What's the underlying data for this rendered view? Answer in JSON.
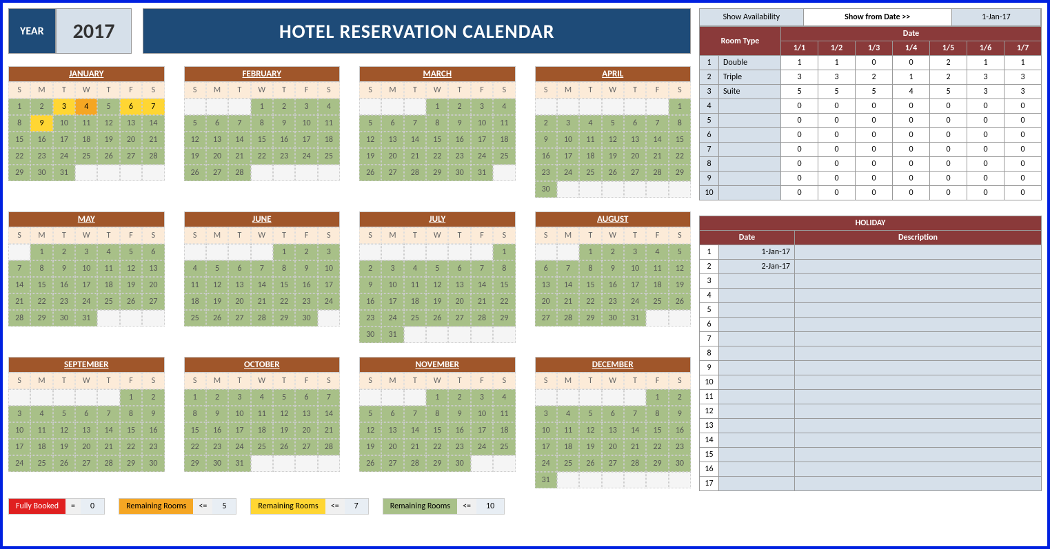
{
  "header": {
    "year_label": "YEAR",
    "year": "2017",
    "title": "HOTEL RESERVATION CALENDAR"
  },
  "dow": [
    "S",
    "M",
    "T",
    "W",
    "T",
    "F",
    "S"
  ],
  "months": [
    {
      "name": "JANUARY",
      "start": 0,
      "days": 31,
      "hl": {
        "3": "y",
        "4": "o",
        "6": "y",
        "7": "y",
        "9": "y"
      }
    },
    {
      "name": "FEBRUARY",
      "start": 3,
      "days": 28
    },
    {
      "name": "MARCH",
      "start": 3,
      "days": 31
    },
    {
      "name": "APRIL",
      "start": 6,
      "days": 30
    },
    {
      "name": "MAY",
      "start": 1,
      "days": 31
    },
    {
      "name": "JUNE",
      "start": 4,
      "days": 30
    },
    {
      "name": "JULY",
      "start": 6,
      "days": 31
    },
    {
      "name": "AUGUST",
      "start": 2,
      "days": 31
    },
    {
      "name": "SEPTEMBER",
      "start": 5,
      "days": 30
    },
    {
      "name": "OCTOBER",
      "start": 0,
      "days": 31
    },
    {
      "name": "NOVEMBER",
      "start": 3,
      "days": 30
    },
    {
      "name": "DECEMBER",
      "start": 5,
      "days": 31
    }
  ],
  "legend": [
    {
      "label": "Fully Booked",
      "cls": "lb-red",
      "op": "=",
      "val": "0"
    },
    {
      "label": "Remaining Rooms",
      "cls": "lb-orange",
      "op": "<=",
      "val": "5"
    },
    {
      "label": "Remaining Rooms",
      "cls": "lb-yellow",
      "op": "<=",
      "val": "7"
    },
    {
      "label": "Remaining Rooms",
      "cls": "lb-green",
      "op": "<=",
      "val": "10"
    }
  ],
  "avail": {
    "btn": "Show Availability",
    "from_label": "Show from Date >>",
    "from_date": "1-Jan-17",
    "room_type_label": "Room Type",
    "date_label": "Date",
    "dates": [
      "1/1",
      "1/2",
      "1/3",
      "1/4",
      "1/5",
      "1/6",
      "1/7"
    ],
    "rows": [
      {
        "n": "1",
        "type": "Double",
        "v": [
          "1",
          "1",
          "0",
          "0",
          "2",
          "1",
          "1"
        ]
      },
      {
        "n": "2",
        "type": "Triple",
        "v": [
          "3",
          "3",
          "2",
          "1",
          "2",
          "3",
          "3"
        ]
      },
      {
        "n": "3",
        "type": "Suite",
        "v": [
          "5",
          "5",
          "5",
          "4",
          "5",
          "3",
          "3"
        ]
      },
      {
        "n": "4",
        "type": "",
        "v": [
          "0",
          "0",
          "0",
          "0",
          "0",
          "0",
          "0"
        ]
      },
      {
        "n": "5",
        "type": "",
        "v": [
          "0",
          "0",
          "0",
          "0",
          "0",
          "0",
          "0"
        ]
      },
      {
        "n": "6",
        "type": "",
        "v": [
          "0",
          "0",
          "0",
          "0",
          "0",
          "0",
          "0"
        ]
      },
      {
        "n": "7",
        "type": "",
        "v": [
          "0",
          "0",
          "0",
          "0",
          "0",
          "0",
          "0"
        ]
      },
      {
        "n": "8",
        "type": "",
        "v": [
          "0",
          "0",
          "0",
          "0",
          "0",
          "0",
          "0"
        ]
      },
      {
        "n": "9",
        "type": "",
        "v": [
          "0",
          "0",
          "0",
          "0",
          "0",
          "0",
          "0"
        ]
      },
      {
        "n": "10",
        "type": "",
        "v": [
          "0",
          "0",
          "0",
          "0",
          "0",
          "0",
          "0"
        ]
      }
    ]
  },
  "holiday": {
    "title": "HOLIDAY",
    "date_label": "Date",
    "desc_label": "Description",
    "rows": [
      {
        "n": "1",
        "date": "1-Jan-17",
        "desc": ""
      },
      {
        "n": "2",
        "date": "2-Jan-17",
        "desc": ""
      },
      {
        "n": "3",
        "date": "",
        "desc": ""
      },
      {
        "n": "4",
        "date": "",
        "desc": ""
      },
      {
        "n": "5",
        "date": "",
        "desc": ""
      },
      {
        "n": "6",
        "date": "",
        "desc": ""
      },
      {
        "n": "7",
        "date": "",
        "desc": ""
      },
      {
        "n": "8",
        "date": "",
        "desc": ""
      },
      {
        "n": "9",
        "date": "",
        "desc": ""
      },
      {
        "n": "10",
        "date": "",
        "desc": ""
      },
      {
        "n": "11",
        "date": "",
        "desc": ""
      },
      {
        "n": "12",
        "date": "",
        "desc": ""
      },
      {
        "n": "13",
        "date": "",
        "desc": ""
      },
      {
        "n": "14",
        "date": "",
        "desc": ""
      },
      {
        "n": "15",
        "date": "",
        "desc": ""
      },
      {
        "n": "16",
        "date": "",
        "desc": ""
      },
      {
        "n": "17",
        "date": "",
        "desc": ""
      }
    ]
  }
}
